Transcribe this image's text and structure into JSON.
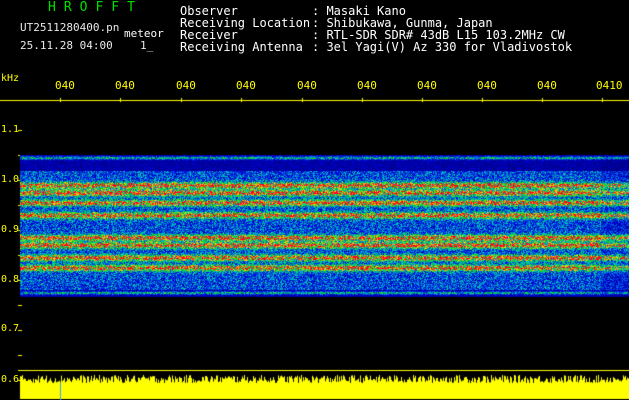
{
  "header": {
    "title": "HROFFT",
    "filename": "UT2511280400.pn",
    "mode": "meteor",
    "datetime": "25.11.28 04:00",
    "marker": "1_"
  },
  "station": [
    {
      "key": "Observer",
      "value": ": Masaki Kano"
    },
    {
      "key": "Receiving Location",
      "value": ": Shibukawa, Gunma, Japan"
    },
    {
      "key": "Receiver",
      "value": ": RTL-SDR SDR# 43dB L15 103.2MHz CW"
    },
    {
      "key": "Receiving Antenna",
      "value": ": 3el Yagi(V) Az 330 for Vladivostok"
    }
  ],
  "y_axis": {
    "unit": "kHz",
    "ticks": [
      "1.1",
      "1.0",
      "0.9",
      "0.8",
      "0.7",
      "0.6"
    ]
  },
  "time_axis": {
    "ticks": [
      "040",
      "040",
      "040",
      "040",
      "040",
      "040",
      "040",
      "040",
      "040",
      "0410"
    ]
  },
  "colors": {
    "background": "#000000",
    "text_yellow": "#ffff00",
    "text_green": "#00e000",
    "noise_floor": "#1a1aff",
    "signal_strong": "#ff2020"
  },
  "signal_bands_khz": [
    0.825,
    0.845,
    0.87,
    0.885,
    0.93,
    0.955,
    0.975,
    0.99,
    1.045,
    0.775
  ]
}
